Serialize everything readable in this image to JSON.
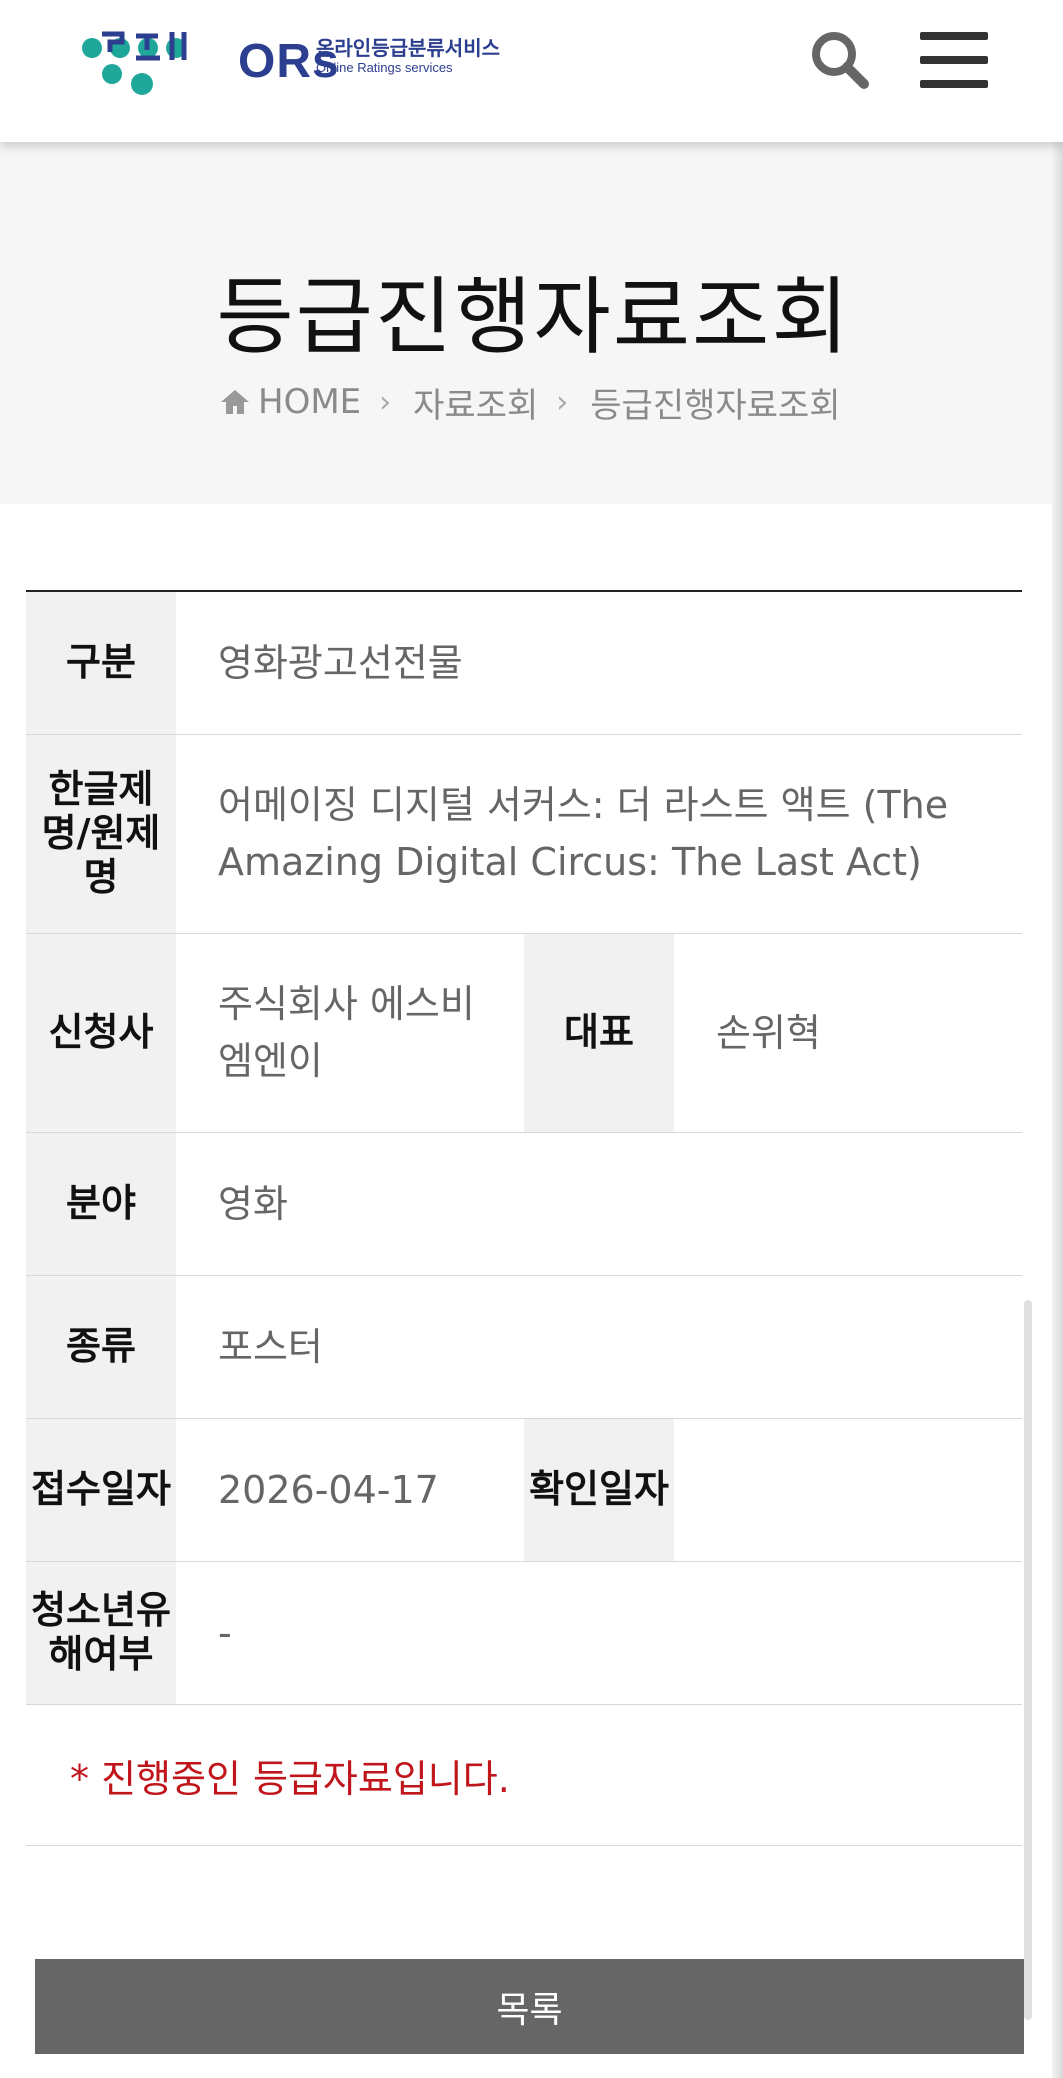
{
  "header": {
    "logo_brand": "ORs",
    "logo_sub_ko": "온라인등급분류서비스",
    "logo_sub_en": "Online Ratings services",
    "logo_mark_text": "영등위",
    "search_icon": "search-icon",
    "menu_icon": "hamburger-menu-icon",
    "brand_color": "#2c3e8f",
    "logo_dot_color": "#1fa89a"
  },
  "hero": {
    "title": "등급진행자료조회",
    "breadcrumb": [
      "HOME",
      "자료조회",
      "등급진행자료조회"
    ]
  },
  "table": {
    "category_label": "구분",
    "category_value": "영화광고선전물",
    "title_label": "한글제명/원제명",
    "title_value": "어메이징 디지털 서커스: 더 라스트 액트 (The Amazing Digital Circus: The Last Act)",
    "applicant_label": "신청사",
    "applicant_value": "주식회사 에스비엠엔이",
    "rep_label": "대표",
    "rep_value": "손위혁",
    "field_label": "분야",
    "field_value": "영화",
    "kind_label": "종류",
    "kind_value": "포스터",
    "received_label": "접수일자",
    "received_value": "2026-04-17",
    "confirmed_label": "확인일자",
    "confirmed_value": "",
    "youth_label": "청소년유해여부",
    "youth_value": "-"
  },
  "notice": "* 진행중인 등급자료입니다.",
  "notice_color": "#c0151b",
  "list_button": "목록"
}
